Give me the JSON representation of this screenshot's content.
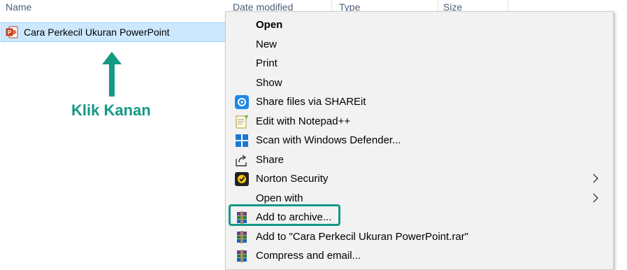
{
  "columns": {
    "name": "Name",
    "date_modified": "Date modified",
    "type": "Type",
    "size": "Size"
  },
  "file": {
    "name": "Cara Perkecil Ukuran PowerPoint",
    "icon": "powerpoint-file-icon"
  },
  "annotation": {
    "text": "Klik Kanan",
    "color": "#149985"
  },
  "menu": {
    "items": [
      {
        "label": "Open",
        "bold": true
      },
      {
        "label": "New"
      },
      {
        "label": "Print"
      },
      {
        "label": "Show"
      },
      {
        "label": "Share files via SHAREit",
        "icon": "shareit-icon"
      },
      {
        "label": "Edit with Notepad++",
        "icon": "notepad-plus-plus-icon"
      },
      {
        "label": "Scan with Windows Defender...",
        "icon": "windows-defender-icon"
      },
      {
        "label": "Share",
        "icon": "share-icon"
      },
      {
        "label": "Norton Security",
        "icon": "norton-icon",
        "submenu": true
      },
      {
        "label": "Open with",
        "submenu": true
      },
      {
        "label": "Add to archive...",
        "icon": "winrar-icon",
        "highlighted": true
      },
      {
        "label": "Add to \"Cara Perkecil Ukuran PowerPoint.rar\"",
        "icon": "winrar-icon"
      },
      {
        "label": "Compress and email...",
        "icon": "winrar-icon"
      }
    ]
  },
  "colors": {
    "selection": "#cce8ff",
    "menu_bg": "#f2f2f2",
    "highlight": "#149985"
  }
}
